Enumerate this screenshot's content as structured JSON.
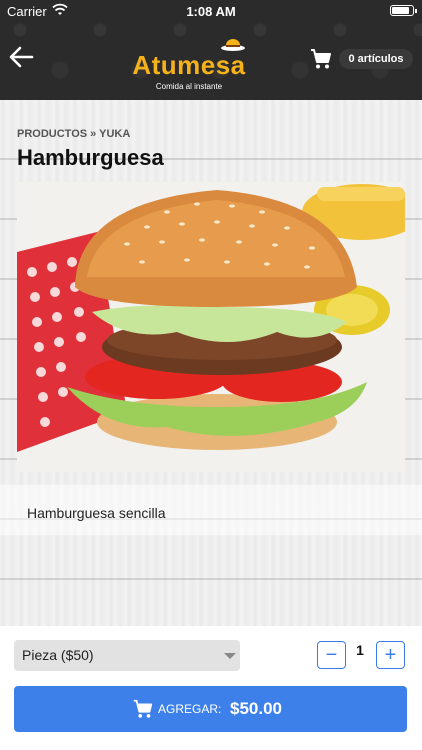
{
  "status_bar": {
    "carrier": "Carrier",
    "time": "1:08 AM"
  },
  "header": {
    "logo_text": "Atumesa",
    "logo_tagline": "Comida al instante",
    "cart_count": "0 artículos"
  },
  "breadcrumb": "PRODUCTOS » YUKA",
  "product": {
    "title": "Hamburguesa",
    "description": "Hamburguesa sencilla"
  },
  "options": {
    "selected": "Pieza ($50)"
  },
  "quantity": {
    "minus": "−",
    "value": "1",
    "plus": "+"
  },
  "add_button": {
    "label": "AGREGAR:",
    "price": "$50.00"
  },
  "colors": {
    "header_bg": "#2b2b2b",
    "brand": "#f5b21a",
    "accent": "#3d80ea"
  }
}
